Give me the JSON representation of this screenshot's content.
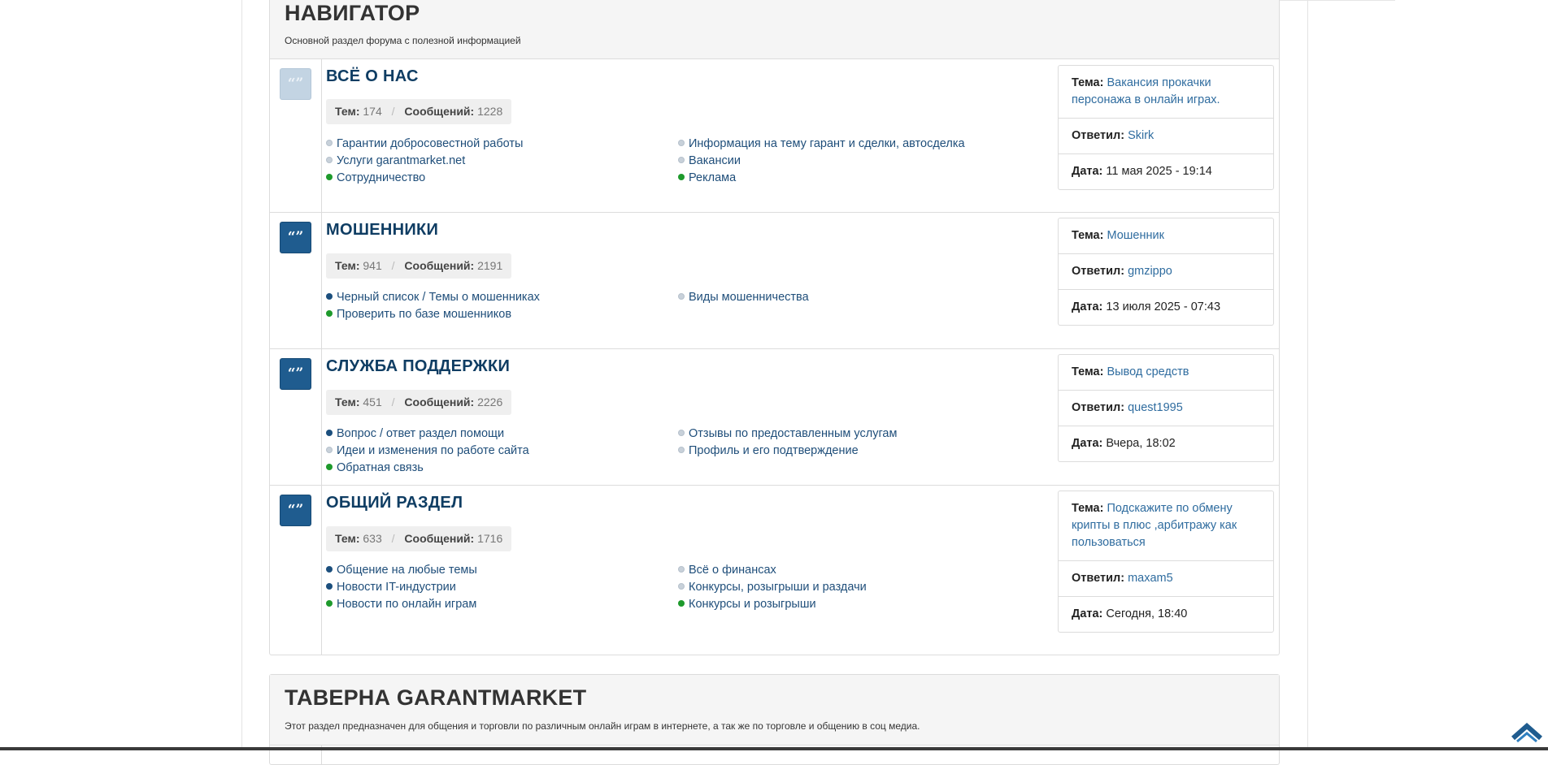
{
  "categories": [
    {
      "title": "НАВИГАТОР",
      "description": "Основной раздел форума с полезной информацией",
      "forums": [
        {
          "title": "ВСЁ О НАС",
          "icon": "quote-icon",
          "stats": {
            "topics_label": "Тем:",
            "topics": "174",
            "sep": "/",
            "posts_label": "Сообщений:",
            "posts": "1228"
          },
          "subforums": [
            {
              "label": "Гарантии добросовестной работы",
              "dot": "grey"
            },
            {
              "label": "Информация на тему гарант и сделки, автосделка",
              "dot": "grey"
            },
            {
              "label": "Услуги garantmarket.net",
              "dot": "grey"
            },
            {
              "label": "Вакансии",
              "dot": "grey"
            },
            {
              "label": "Сотрудничество",
              "dot": "green"
            },
            {
              "label": "Реклама",
              "dot": "green"
            }
          ],
          "last": {
            "topic_label": "Тема:",
            "topic": "Вакансия прокачки персонажа в онлайн играх.",
            "author_label": "Ответил:",
            "author": "Skirk",
            "date_label": "Дата:",
            "date": "11 мая 2025 - 19:14"
          }
        },
        {
          "title": "МОШЕННИКИ",
          "icon": "quote-icon",
          "stats": {
            "topics_label": "Тем:",
            "topics": "941",
            "sep": "/",
            "posts_label": "Сообщений:",
            "posts": "2191"
          },
          "subforums": [
            {
              "label": "Черный список / Темы о мошенниках",
              "dot": "blue"
            },
            {
              "label": "Виды мошенничества",
              "dot": "grey"
            },
            {
              "label": "Проверить по базе мошенников",
              "dot": "green"
            }
          ],
          "last": {
            "topic_label": "Тема:",
            "topic": "Мошенник",
            "author_label": "Ответил:",
            "author": "gmzippo",
            "date_label": "Дата:",
            "date": "13 июля 2025 - 07:43"
          }
        },
        {
          "title": "СЛУЖБА ПОДДЕРЖКИ",
          "icon": "quote-icon",
          "stats": {
            "topics_label": "Тем:",
            "topics": "451",
            "sep": "/",
            "posts_label": "Сообщений:",
            "posts": "2226"
          },
          "subforums": [
            {
              "label": "Вопрос / ответ раздел помощи",
              "dot": "blue"
            },
            {
              "label": "Отзывы по предоставленным услугам",
              "dot": "grey"
            },
            {
              "label": "Идеи и изменения по работе сайта",
              "dot": "grey"
            },
            {
              "label": "Профиль и его подтверждение",
              "dot": "grey"
            },
            {
              "label": "Обратная связь",
              "dot": "green"
            }
          ],
          "last": {
            "topic_label": "Тема:",
            "topic": "Вывод средств",
            "author_label": "Ответил:",
            "author": "quest1995",
            "date_label": "Дата:",
            "date": "Вчера, 18:02"
          }
        },
        {
          "title": "ОБЩИЙ РАЗДЕЛ",
          "icon": "quote-icon",
          "stats": {
            "topics_label": "Тем:",
            "topics": "633",
            "sep": "/",
            "posts_label": "Сообщений:",
            "posts": "1716"
          },
          "subforums": [
            {
              "label": "Общение на любые темы",
              "dot": "blue"
            },
            {
              "label": "Всё о финансах",
              "dot": "grey"
            },
            {
              "label": "Новости IT-индустрии",
              "dot": "blue"
            },
            {
              "label": "Конкурсы, розыгрыши и раздачи",
              "dot": "grey"
            },
            {
              "label": "Новости по онлайн играм",
              "dot": "green"
            },
            {
              "label": "Конкурсы и розыгрыши",
              "dot": "green"
            }
          ],
          "last": {
            "topic_label": "Тема:",
            "topic": "Подскажите по обмену крипты в плюс ,арбитражу как пользоваться",
            "author_label": "Ответил:",
            "author": "maxam5",
            "date_label": "Дата:",
            "date": "Сегодня, 18:40"
          }
        }
      ]
    },
    {
      "title": "ТАВЕРНА GARANTMARKET",
      "description": "Этот раздел предназначен для общения и торговли по различным онлайн играм в интернете, а так же по торговле и общению в соц медиа."
    }
  ],
  "colors": {
    "accent": "#1f5c8f",
    "link": "#2f6c9f",
    "title": "#0f3d63",
    "dot_grey": "#c8d1da",
    "dot_blue": "#1c4f7d",
    "dot_green": "#1e9a2c"
  },
  "scroll_top_icon": "chevron-up-icon"
}
